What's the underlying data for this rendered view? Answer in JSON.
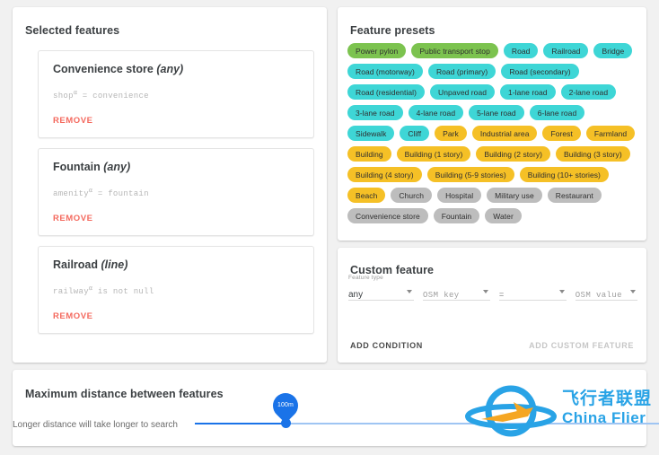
{
  "selected_features": {
    "title": "Selected features",
    "cards": [
      {
        "name": "Convenience store",
        "geometry": "(any)",
        "condition_key": "shop",
        "condition_rest": " = convenience",
        "remove_label": "REMOVE"
      },
      {
        "name": "Fountain",
        "geometry": "(any)",
        "condition_key": "amenity",
        "condition_rest": " = fountain",
        "remove_label": "REMOVE"
      },
      {
        "name": "Railroad",
        "geometry": "(line)",
        "condition_key": "railway",
        "condition_rest": " is not null",
        "remove_label": "REMOVE"
      }
    ]
  },
  "feature_presets": {
    "title": "Feature presets",
    "colors": {
      "green": "#7cc34f",
      "cyan": "#3ed6d6",
      "amber": "#f5c026",
      "gray": "#bdbdbd"
    },
    "chips": [
      {
        "label": "Power pylon",
        "color": "green"
      },
      {
        "label": "Public transport stop",
        "color": "green"
      },
      {
        "label": "Road",
        "color": "cyan"
      },
      {
        "label": "Railroad",
        "color": "cyan"
      },
      {
        "label": "Bridge",
        "color": "cyan"
      },
      {
        "label": "Road (motorway)",
        "color": "cyan"
      },
      {
        "label": "Road (primary)",
        "color": "cyan"
      },
      {
        "label": "Road (secondary)",
        "color": "cyan"
      },
      {
        "label": "Road (residential)",
        "color": "cyan"
      },
      {
        "label": "Unpaved road",
        "color": "cyan"
      },
      {
        "label": "1-lane road",
        "color": "cyan"
      },
      {
        "label": "2-lane road",
        "color": "cyan"
      },
      {
        "label": "3-lane road",
        "color": "cyan"
      },
      {
        "label": "4-lane road",
        "color": "cyan"
      },
      {
        "label": "5-lane road",
        "color": "cyan"
      },
      {
        "label": "6-lane road",
        "color": "cyan"
      },
      {
        "label": "Sidewalk",
        "color": "cyan"
      },
      {
        "label": "Cliff",
        "color": "cyan"
      },
      {
        "label": "Park",
        "color": "amber"
      },
      {
        "label": "Industrial area",
        "color": "amber"
      },
      {
        "label": "Forest",
        "color": "amber"
      },
      {
        "label": "Farmland",
        "color": "amber"
      },
      {
        "label": "Building",
        "color": "amber"
      },
      {
        "label": "Building (1 story)",
        "color": "amber"
      },
      {
        "label": "Building (2 story)",
        "color": "amber"
      },
      {
        "label": "Building (3 story)",
        "color": "amber"
      },
      {
        "label": "Building (4 story)",
        "color": "amber"
      },
      {
        "label": "Building (5-9 stories)",
        "color": "amber"
      },
      {
        "label": "Building (10+ stories)",
        "color": "amber"
      },
      {
        "label": "Beach",
        "color": "amber"
      },
      {
        "label": "Church",
        "color": "gray"
      },
      {
        "label": "Hospital",
        "color": "gray"
      },
      {
        "label": "Military use",
        "color": "gray"
      },
      {
        "label": "Restaurant",
        "color": "gray"
      },
      {
        "label": "Convenience store",
        "color": "gray"
      },
      {
        "label": "Fountain",
        "color": "gray"
      },
      {
        "label": "Water",
        "color": "gray"
      }
    ]
  },
  "custom_feature": {
    "title": "Custom feature",
    "feature_type_label": "Feature type",
    "feature_type_value": "any",
    "osm_key_value": "OSM key",
    "operator_value": "=",
    "osm_value_value": "OSM value",
    "add_condition_label": "ADD CONDITION",
    "add_custom_feature_label": "ADD CUSTOM FEATURE"
  },
  "distance": {
    "title": "Maximum distance between features",
    "hint": "Longer distance will take longer to search",
    "value_label": "100m"
  },
  "watermark": {
    "text_cn": "飞行者联盟",
    "text_en": "China Flier"
  }
}
